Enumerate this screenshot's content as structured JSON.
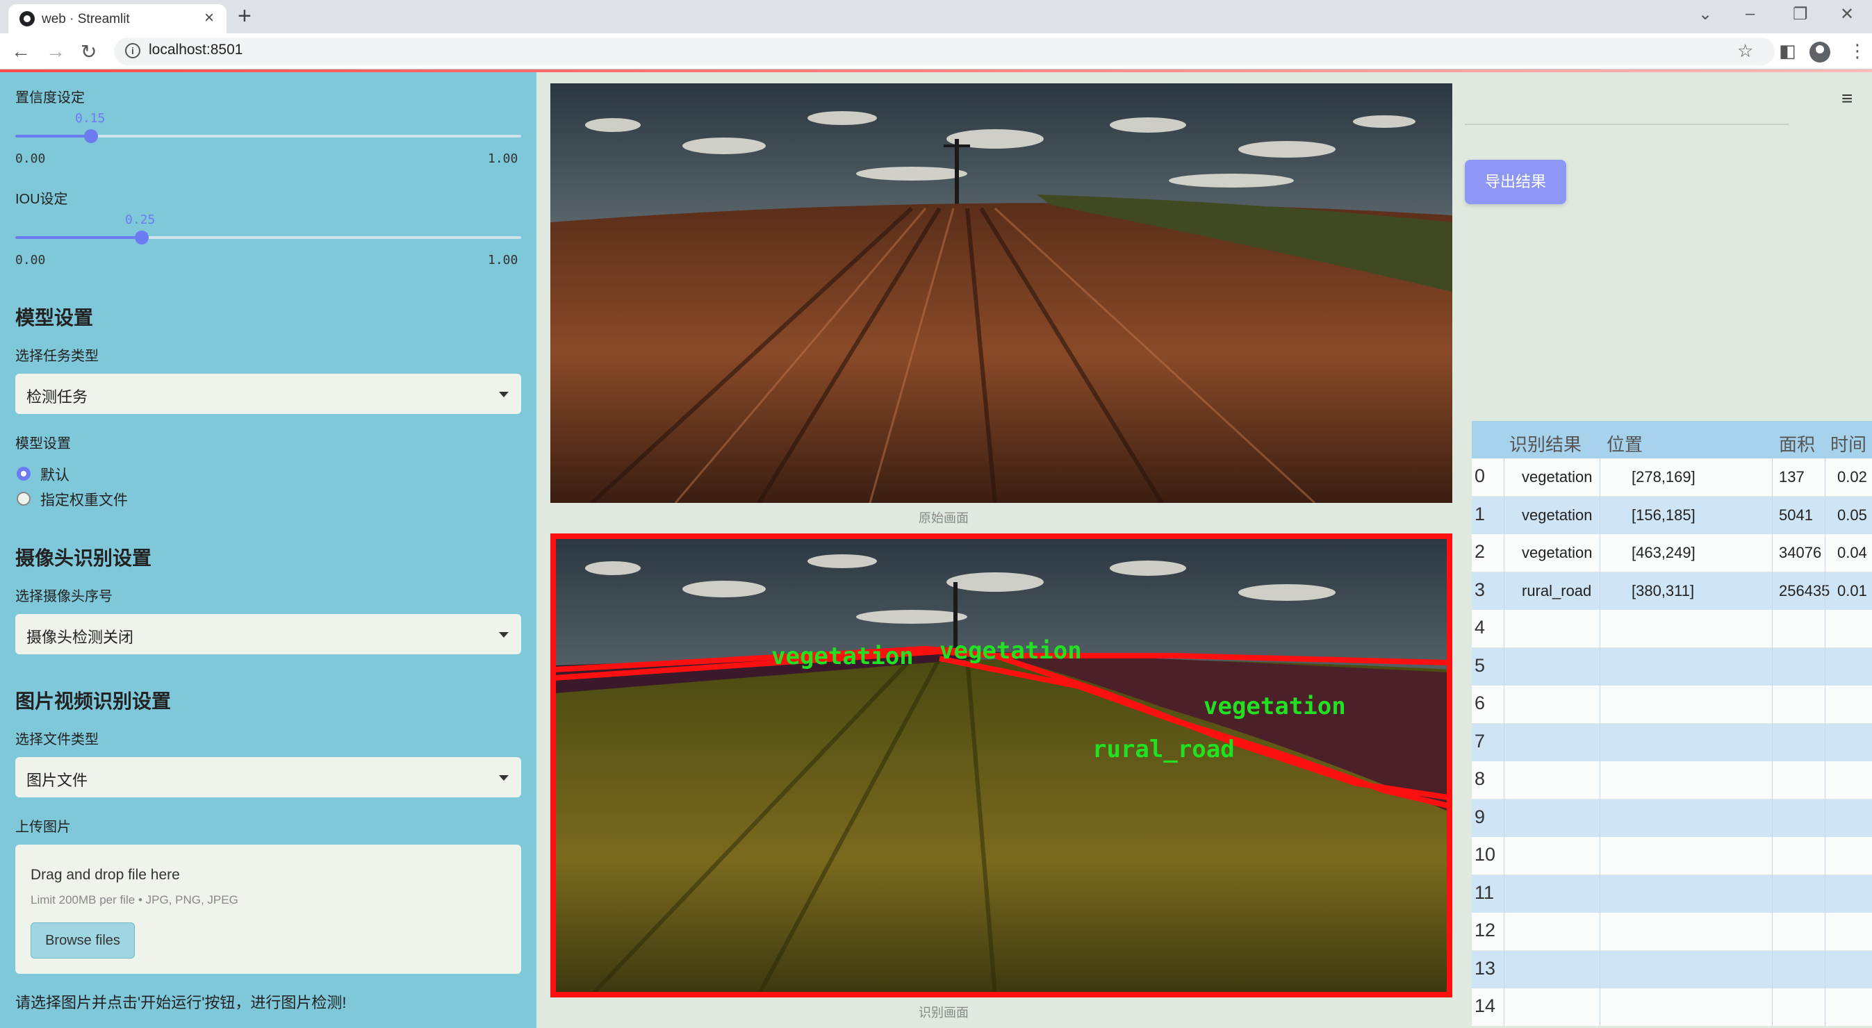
{
  "browser": {
    "tab_title": "web · Streamlit",
    "url": "localhost:8501"
  },
  "sidebar": {
    "confidence": {
      "label": "置信度设定",
      "value": "0.15",
      "min": "0.00",
      "max": "1.00",
      "fraction": 0.15
    },
    "iou": {
      "label": "IOU设定",
      "value": "0.25",
      "min": "0.00",
      "max": "1.00",
      "fraction": 0.25
    },
    "model_section": "模型设置",
    "task_type_label": "选择任务类型",
    "task_type_value": "检测任务",
    "model_setting_label": "模型设置",
    "radio_default": "默认",
    "radio_custom": "指定权重文件",
    "camera_section": "摄像头识别设置",
    "camera_label": "选择摄像头序号",
    "camera_value": "摄像头检测关闭",
    "media_section": "图片视频识别设置",
    "file_type_label": "选择文件类型",
    "file_type_value": "图片文件",
    "upload_label": "上传图片",
    "upload_title": "Drag and drop file here",
    "upload_hint": "Limit 200MB per file • JPG, PNG, JPEG",
    "browse_label": "Browse files",
    "tip": "请选择图片并点击'开始运行'按钮，进行图片检测!"
  },
  "main": {
    "original_caption": "原始画面",
    "result_caption": "识别画面",
    "export_label": "导出结果",
    "overlay_labels": [
      "vegetation",
      "vegetation",
      "vegetation",
      "rural_road"
    ]
  },
  "table": {
    "headers": [
      "识别结果",
      "位置",
      "面积",
      "时间"
    ],
    "rows": [
      {
        "idx": "0",
        "label": "vegetation",
        "pos": "[278,169]",
        "area": "137",
        "time": "0.02"
      },
      {
        "idx": "1",
        "label": "vegetation",
        "pos": "[156,185]",
        "area": "5041",
        "time": "0.05"
      },
      {
        "idx": "2",
        "label": "vegetation",
        "pos": "[463,249]",
        "area": "34076",
        "time": "0.04"
      },
      {
        "idx": "3",
        "label": "rural_road",
        "pos": "[380,311]",
        "area": "256435",
        "time": "0.01"
      }
    ],
    "empty_indices": [
      "4",
      "5",
      "6",
      "7",
      "8",
      "9",
      "10",
      "11",
      "12",
      "13",
      "14"
    ]
  },
  "colors": {
    "sidebar": "#7ec8da",
    "accent": "#6d7bf2",
    "export": "#8e97f5",
    "overlay_label": "#22e022",
    "overlay_outline": "#ff1010"
  }
}
